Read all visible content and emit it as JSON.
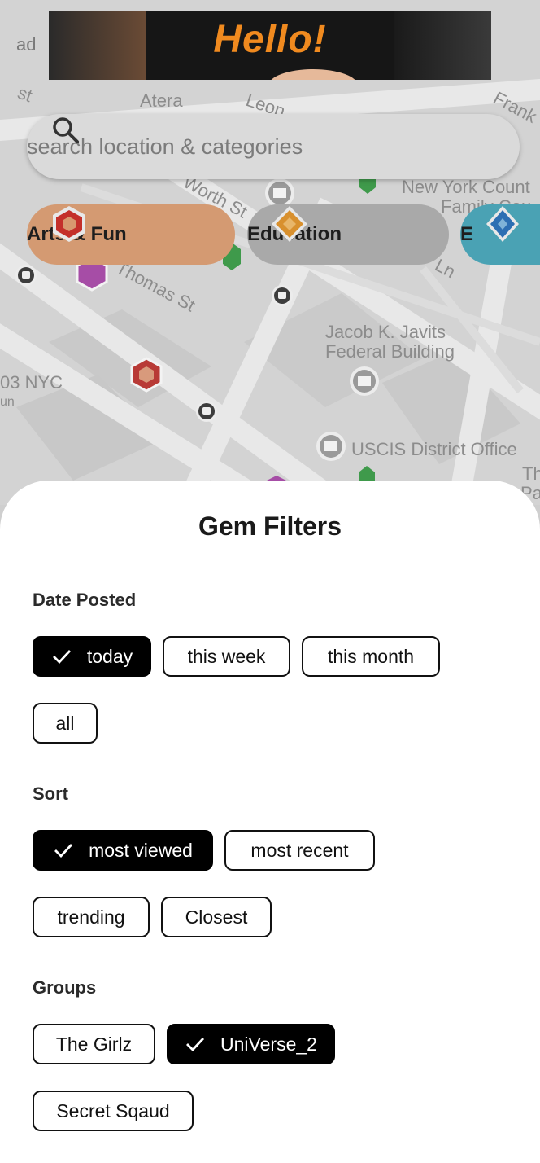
{
  "ad": {
    "label": "ad",
    "banner_text": "Hello!"
  },
  "search": {
    "placeholder": "search location & categories",
    "icon": "search-icon"
  },
  "categories": [
    {
      "label": "Arts & Fun",
      "color": "#e0a276",
      "gem": "#c4302b"
    },
    {
      "label": "Education",
      "color": "#a7a7a7",
      "gem": "#d8902e"
    },
    {
      "label": "E",
      "color": "#4fa6b8",
      "gem": "#2d6fb3"
    }
  ],
  "map": {
    "labels": [
      "Atera",
      "Leon",
      "Frank",
      "New York Count",
      "Family Cou",
      "Worth St",
      "Thomas St",
      "Ln",
      "Jacob K. Javits",
      "Federal Building",
      "03 NYC",
      "un",
      "USCIS District Office",
      "Th",
      "Pai",
      "st"
    ]
  },
  "filters": {
    "title": "Gem Filters",
    "date_posted": {
      "heading": "Date Posted",
      "options": [
        "today",
        "this week",
        "this month",
        "all"
      ],
      "selected": "today"
    },
    "sort": {
      "heading": "Sort",
      "options": [
        "most viewed",
        "most recent",
        "trending",
        "Closest"
      ],
      "selected": "most viewed"
    },
    "groups": {
      "heading": "Groups",
      "options": [
        "The Girlz",
        "UniVerse_2",
        "Secret Sqaud"
      ],
      "selected": "UniVerse_2"
    }
  }
}
